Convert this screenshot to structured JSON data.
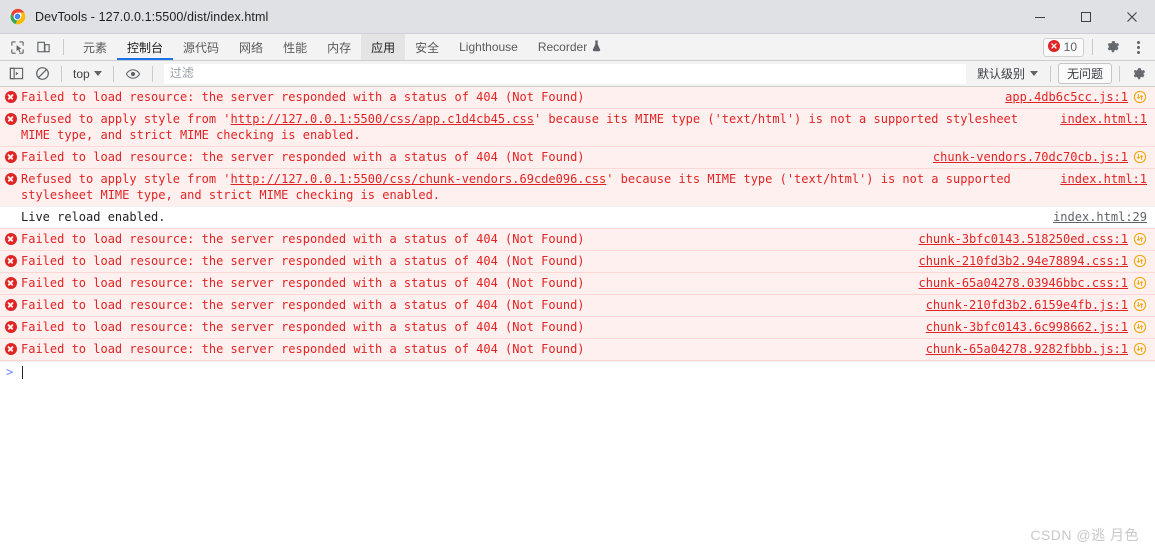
{
  "window": {
    "title": "DevTools - 127.0.0.1:5500/dist/index.html",
    "minimize_label": "最小化",
    "maximize_label": "最大化",
    "close_label": "关闭"
  },
  "tabbar": {
    "inspect_icon": "inspect-element-icon",
    "device_icon": "device-toolbar-icon",
    "tabs": [
      {
        "label": "元素",
        "state": "normal"
      },
      {
        "label": "控制台",
        "state": "selected"
      },
      {
        "label": "源代码",
        "state": "normal"
      },
      {
        "label": "网络",
        "state": "normal"
      },
      {
        "label": "性能",
        "state": "normal"
      },
      {
        "label": "内存",
        "state": "normal"
      },
      {
        "label": "应用",
        "state": "active-panel"
      },
      {
        "label": "安全",
        "state": "normal"
      },
      {
        "label": "Lighthouse",
        "state": "normal"
      },
      {
        "label": "Recorder",
        "state": "normal",
        "icon": "flask-icon"
      }
    ],
    "error_count": "10",
    "settings_icon": "gear-icon",
    "more_icon": "more-vertical-icon"
  },
  "filterbar": {
    "sidebar_icon": "console-sidebar-icon",
    "clear_icon": "clear-console-icon",
    "context": "top",
    "eye_icon": "live-expression-icon",
    "filter_placeholder": "过滤",
    "filter_value": "",
    "level": "默认级别",
    "issues": "无问题",
    "settings_icon": "gear-icon"
  },
  "console": {
    "messages": [
      {
        "type": "error",
        "text": "Failed to load resource: the server responded with a status of 404 (Not Found)",
        "source": "app.4db6c5cc.js:1",
        "has_network_icon": true
      },
      {
        "type": "error",
        "text_before": "Refused to apply style from '",
        "url": "http://127.0.0.1:5500/css/app.c1d4cb45.css",
        "text_after": "' because its MIME type ('text/html') is not a supported stylesheet MIME type, and strict MIME checking is enabled.",
        "source": "index.html:1",
        "has_network_icon": false
      },
      {
        "type": "error",
        "text": "Failed to load resource: the server responded with a status of 404 (Not Found)",
        "source": "chunk-vendors.70dc70cb.js:1",
        "has_network_icon": true
      },
      {
        "type": "error",
        "text_before": "Refused to apply style from '",
        "url": "http://127.0.0.1:5500/css/chunk-vendors.69cde096.css",
        "text_after": "' because its MIME type ('text/html') is not a supported stylesheet MIME type, and strict MIME checking is enabled.",
        "source": "index.html:1",
        "has_network_icon": false
      },
      {
        "type": "log",
        "text": "Live reload enabled.",
        "source": "index.html:29",
        "has_network_icon": false
      },
      {
        "type": "error",
        "text": "Failed to load resource: the server responded with a status of 404 (Not Found)",
        "source": "chunk-3bfc0143.518250ed.css:1",
        "has_network_icon": true
      },
      {
        "type": "error",
        "text": "Failed to load resource: the server responded with a status of 404 (Not Found)",
        "source": "chunk-210fd3b2.94e78894.css:1",
        "has_network_icon": true
      },
      {
        "type": "error",
        "text": "Failed to load resource: the server responded with a status of 404 (Not Found)",
        "source": "chunk-65a04278.03946bbc.css:1",
        "has_network_icon": true
      },
      {
        "type": "error",
        "text": "Failed to load resource: the server responded with a status of 404 (Not Found)",
        "source": "chunk-210fd3b2.6159e4fb.js:1",
        "has_network_icon": true
      },
      {
        "type": "error",
        "text": "Failed to load resource: the server responded with a status of 404 (Not Found)",
        "source": "chunk-3bfc0143.6c998662.js:1",
        "has_network_icon": true
      },
      {
        "type": "error",
        "text": "Failed to load resource: the server responded with a status of 404 (Not Found)",
        "source": "chunk-65a04278.9282fbbb.js:1",
        "has_network_icon": true
      }
    ],
    "prompt_symbol": ">",
    "prompt_value": ""
  },
  "watermark": "CSDN @逃 月色",
  "colors": {
    "error_text": "#e02424",
    "error_bg": "#fff0f0",
    "accent": "#1a73e8",
    "titlebar_bg": "#dfe1e5",
    "toolbar_bg": "#f3f3f3"
  }
}
